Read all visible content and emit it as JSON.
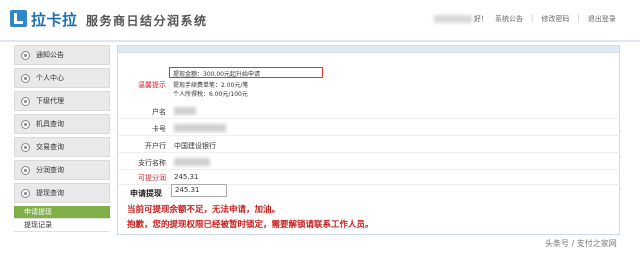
{
  "header": {
    "brand": "拉卡拉",
    "system_title": "服务商日结分润系统",
    "greeting": "好！",
    "links": [
      "系统公告",
      "修改密码",
      "退出登录"
    ]
  },
  "sidebar": {
    "items": [
      {
        "label": "通知公告"
      },
      {
        "label": "个人中心"
      },
      {
        "label": "下级代理"
      },
      {
        "label": "机具查询"
      },
      {
        "label": "交易查询"
      },
      {
        "label": "分润查询"
      },
      {
        "label": "提现查询"
      }
    ],
    "sub_items": [
      {
        "label": "申请提现",
        "active": true
      },
      {
        "label": "提现记录",
        "active": false
      }
    ]
  },
  "form": {
    "tip_label": "温馨提示",
    "tip_box": "提现金额：300.00元起升始申请",
    "tip_fee": "提现手续费单笔：2.00元/笔",
    "tip_tax": "个人所得税：6.00元/100元",
    "rows": [
      {
        "label": "户名",
        "value": ""
      },
      {
        "label": "卡号",
        "value": ""
      },
      {
        "label": "开户行",
        "value": "中国建设银行"
      },
      {
        "label": "支行名称",
        "value": ""
      },
      {
        "label": "可提分润",
        "value": "245.31"
      }
    ],
    "apply_label": "申请提现",
    "apply_value": "245.31",
    "warning_1": "当前可提现余额不足，无法申请，加油。",
    "warning_2": "抱歉，您的提现权限已经被暂时锁定，需要解锁请联系工作人员。"
  },
  "watermark": "头条号 / 支付之家网",
  "colors": {
    "brand_blue": "#1d6fb3",
    "active_green": "#7fb048",
    "warning_red": "#c81d1d",
    "tip_box_border": "#d9372c"
  }
}
